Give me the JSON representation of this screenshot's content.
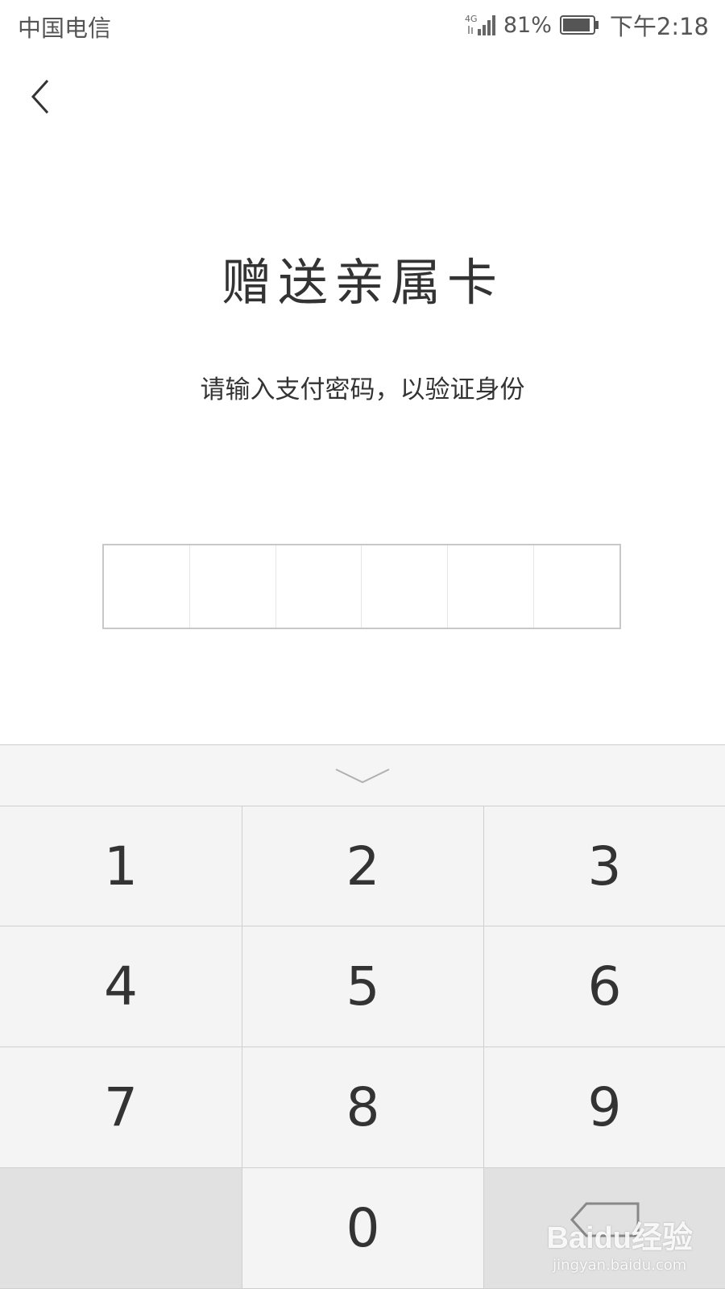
{
  "status_bar": {
    "carrier": "中国电信",
    "network": "4G",
    "battery_percent": "81%",
    "time": "下午2:18"
  },
  "nav": {
    "back_icon": "chevron-left-icon"
  },
  "page": {
    "title": "赠送亲属卡",
    "subtitle": "请输入支付密码，以验证身份"
  },
  "password": {
    "length": 6,
    "entered": 0
  },
  "keypad": {
    "collapse_icon": "chevron-down-icon",
    "keys": [
      "1",
      "2",
      "3",
      "4",
      "5",
      "6",
      "7",
      "8",
      "9",
      "",
      "0",
      ""
    ],
    "delete_icon": "backspace-icon"
  },
  "watermark": {
    "logo": "Baidu经验",
    "url": "jingyan.baidu.com"
  }
}
